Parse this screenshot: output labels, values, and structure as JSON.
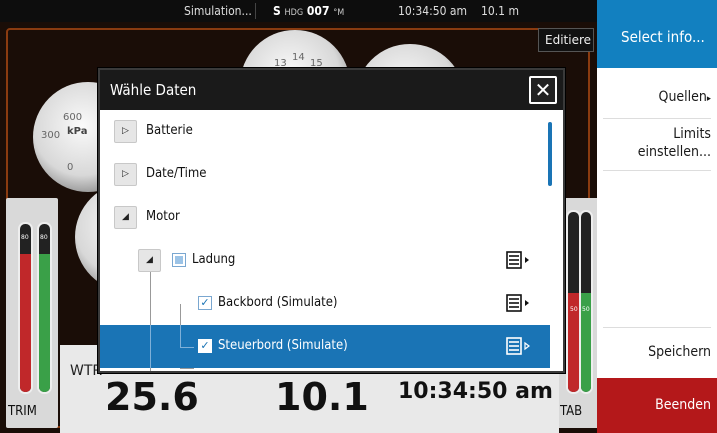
{
  "status_bar": {
    "simulation": "Simulation...",
    "hdg_prefix": "S",
    "hdg_label": "HDG",
    "hdg_value": "007",
    "hdg_unit": "°M",
    "time": "10:34:50 am",
    "depth": "10.1 m"
  },
  "dashboard": {
    "edit_label": "Editiere",
    "gauge_kpa_unit": "kPa",
    "gauge_kpa_600": "600",
    "gauge_kpa_300": "300",
    "gauge_kpa_0": "0",
    "gauge_top_14": "14",
    "gauge_top_13": "13",
    "gauge_top_15": "15",
    "trim_label": "TRIM",
    "tab_label": "TAB",
    "bar_value_left": "80",
    "bar_value_right": "80",
    "tab_bar_left": "50",
    "tab_bar_right": "50",
    "trim_left_level": 0.82,
    "trim_right_level": 0.82,
    "tab_left_level": 0.55,
    "tab_right_level": 0.55,
    "readout_label": "WTR",
    "readout_1": "25.6",
    "readout_2": "10.1",
    "readout_3": "10:34:50 am"
  },
  "menu": {
    "select_info": "Select info...",
    "quellen": "Quellen",
    "limits_1": "Limits",
    "limits_2": "einstellen...",
    "speichern": "Speichern",
    "beenden": "Beenden"
  },
  "dialog": {
    "title": "Wähle Daten",
    "close": "✕",
    "items": [
      {
        "label": "Batterie"
      },
      {
        "label": "Date/Time"
      },
      {
        "label": "Motor"
      },
      {
        "label": "Ladung"
      },
      {
        "label": "Backbord (Simulate)"
      },
      {
        "label": "Steuerbord (Simulate)"
      }
    ]
  },
  "colors": {
    "accent_blue": "#1a74b5",
    "menu_blue": "#1280c0",
    "beenden_red": "#b4181a",
    "bar_red": "#c0282a",
    "bar_green": "#3aa048"
  }
}
